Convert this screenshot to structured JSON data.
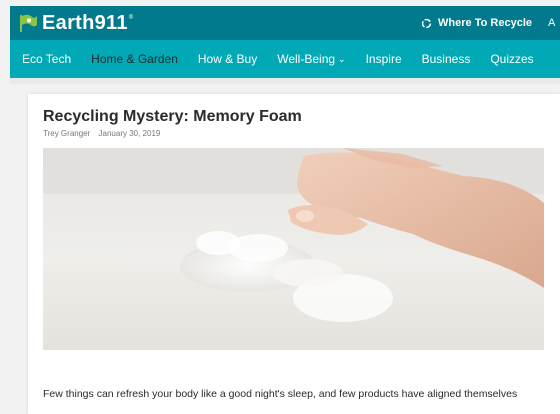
{
  "header": {
    "logo_text": "Earth911",
    "logo_reg": "®",
    "where_to_recycle": "Where To Recycle",
    "truncated_next": "A",
    "colors": {
      "top": "#007a8c",
      "nav": "#00a9b5"
    }
  },
  "nav": {
    "items": [
      {
        "label": "Eco Tech",
        "active": false,
        "dropdown": false
      },
      {
        "label": "Home & Garden",
        "active": true,
        "dropdown": false
      },
      {
        "label": "How & Buy",
        "active": false,
        "dropdown": false
      },
      {
        "label": "Well-Being",
        "active": false,
        "dropdown": true
      },
      {
        "label": "Inspire",
        "active": false,
        "dropdown": false
      },
      {
        "label": "Business",
        "active": false,
        "dropdown": false
      },
      {
        "label": "Quizzes",
        "active": false,
        "dropdown": false
      }
    ]
  },
  "article": {
    "title": "Recycling Mystery: Memory Foam",
    "author": "Trey Granger",
    "date": "January 30, 2019",
    "intro": "Few things can refresh your body like a good night's sleep, and few products have aligned themselves"
  }
}
